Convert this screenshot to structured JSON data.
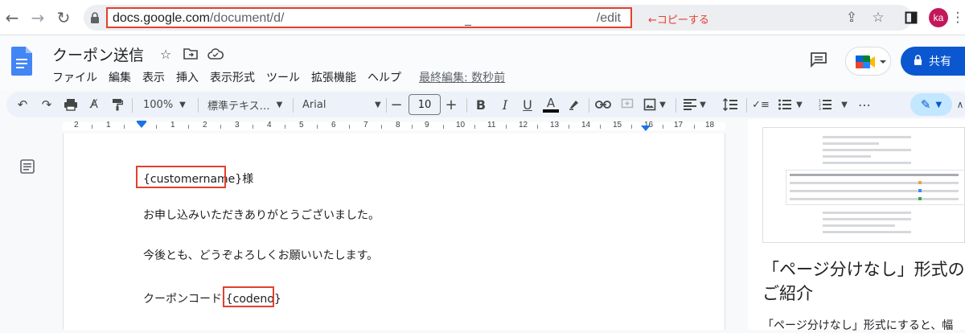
{
  "browser": {
    "url_host": "docs.google.com",
    "url_path": "/document/d/",
    "url_mid": "_",
    "url_end": "/edit",
    "copy_note": "←コピーする",
    "avatar_initials": "ka"
  },
  "doc": {
    "title": "クーポン送信",
    "menu": [
      "ファイル",
      "編集",
      "表示",
      "挿入",
      "表示形式",
      "ツール",
      "拡張機能",
      "ヘルプ"
    ],
    "last_edit": "最終編集: 数秒前",
    "share_label": "共有"
  },
  "toolbar": {
    "zoom": "100%",
    "style": "標準テキス…",
    "font": "Arial",
    "font_size": "10"
  },
  "ruler": {
    "labels": [
      "2",
      "1",
      "1",
      "2",
      "3",
      "4",
      "5",
      "6",
      "7",
      "8",
      "9",
      "10",
      "11",
      "12",
      "13",
      "14",
      "15",
      "16",
      "17",
      "18"
    ]
  },
  "body": {
    "line1_placeholder": "{customername}",
    "line1_suffix": "様",
    "line2": "お申し込みいただきありがとうございました。",
    "line3": "今後とも、どうぞよろしくお願いいたします。",
    "line4_prefix": "クーポンコード:",
    "line4_placeholder": "{codeno}"
  },
  "side_panel": {
    "title": "「ページ分けなし」形式のご紹介",
    "text": "「ページ分けなし」形式にすると、幅"
  },
  "colors": {
    "accent_blue": "#0b57d0",
    "annotation_red": "#e2412f"
  }
}
